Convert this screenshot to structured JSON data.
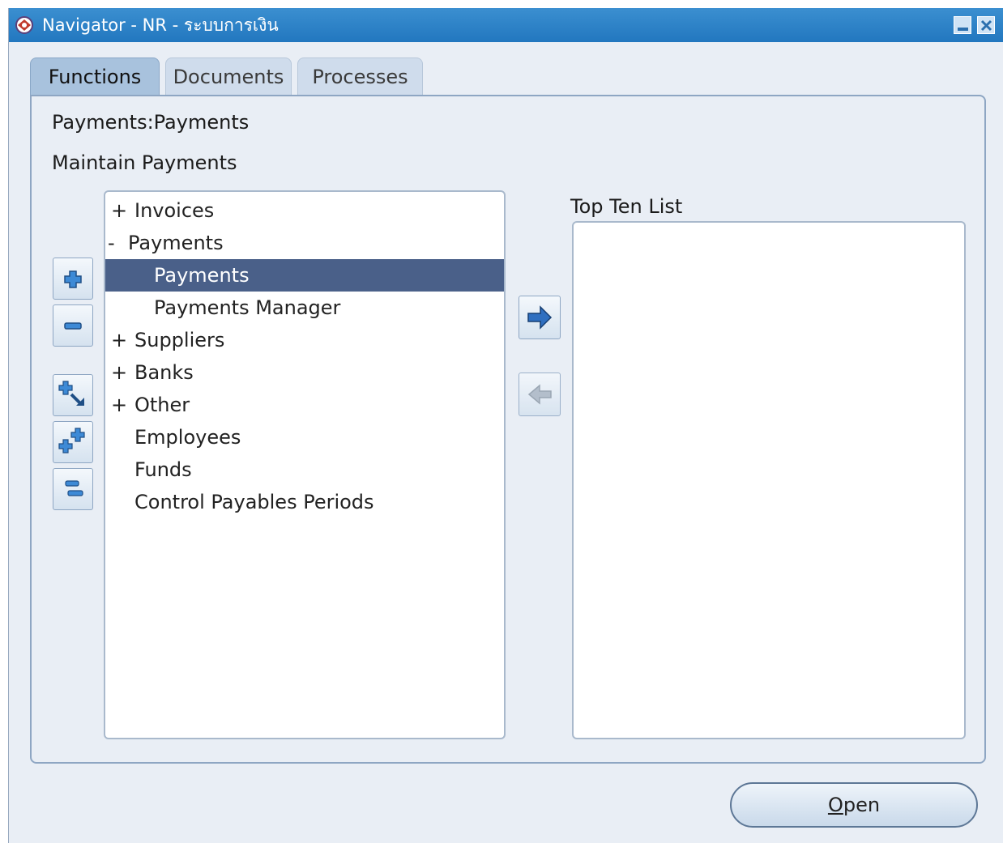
{
  "window": {
    "title": "Navigator - NR - ระบบการเงิน",
    "accent_color": "#2a7fc4",
    "selection_color": "#4a6089"
  },
  "tabs": [
    {
      "label": "Functions",
      "active": true
    },
    {
      "label": "Documents",
      "active": false
    },
    {
      "label": "Processes",
      "active": false
    }
  ],
  "functions": {
    "path_label": "Payments:Payments",
    "description": "Maintain Payments",
    "tree": [
      {
        "mark": "+",
        "label": "Invoices",
        "level": 0,
        "selected": false
      },
      {
        "mark": "-",
        "label": "Payments",
        "level": 0,
        "selected": false
      },
      {
        "mark": "",
        "label": "Payments",
        "level": 1,
        "selected": true
      },
      {
        "mark": "",
        "label": "Payments Manager",
        "level": 1,
        "selected": false
      },
      {
        "mark": "+",
        "label": "Suppliers",
        "level": 0,
        "selected": false
      },
      {
        "mark": "+",
        "label": "Banks",
        "level": 0,
        "selected": false
      },
      {
        "mark": "+",
        "label": "Other",
        "level": 0,
        "selected": false
      },
      {
        "mark": "",
        "label": "Employees",
        "level": 0,
        "selected": false
      },
      {
        "mark": "",
        "label": "Funds",
        "level": 0,
        "selected": false
      },
      {
        "mark": "",
        "label": "Control Payables Periods",
        "level": 0,
        "selected": false
      }
    ],
    "side_buttons": [
      {
        "icon": "expand-plus-icon"
      },
      {
        "icon": "collapse-minus-icon"
      },
      {
        "icon": "expand-branch-icon"
      },
      {
        "icon": "expand-all-icon"
      },
      {
        "icon": "collapse-all-icon"
      }
    ],
    "add_icon": "right-arrow-icon",
    "remove_icon": "left-arrow-icon",
    "top_ten_label": "Top Ten List",
    "top_ten_items": []
  },
  "footer": {
    "open_mnemonic": "O",
    "open_rest": "pen"
  }
}
